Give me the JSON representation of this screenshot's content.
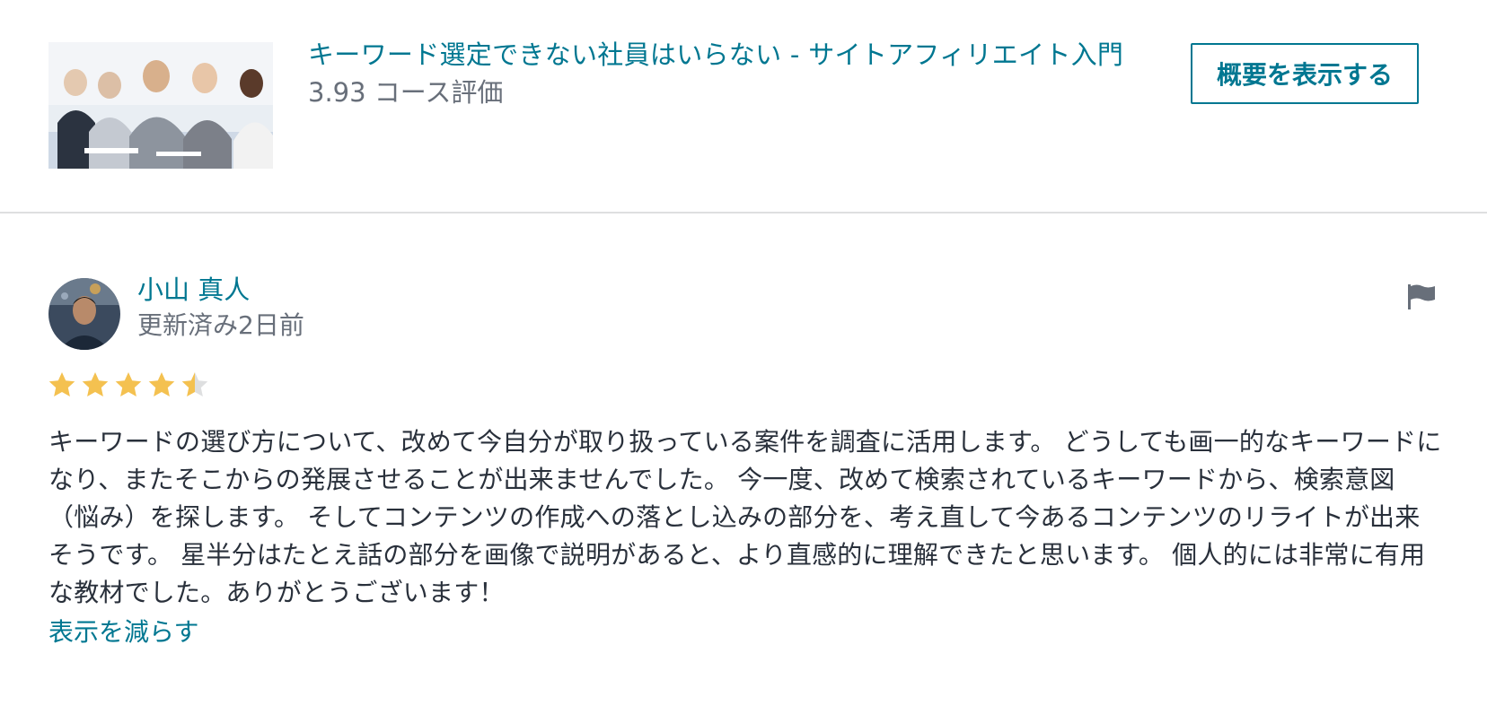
{
  "course": {
    "title": "キーワード選定できない社員はいらない - サイトアフィリエイト入門",
    "rating_text": "3.93 コース評価",
    "overview_button": "概要を表示する",
    "thumbnail_icon": "course-thumbnail-image"
  },
  "review": {
    "reviewer_name": "小山 真人",
    "updated": "更新済み2日前",
    "rating": 4.5,
    "max_rating": 5,
    "text": "キーワードの選び方について、改めて今自分が取り扱っている案件を調査に活用します。 どうしても画一的なキーワードになり、またそこからの発展させることが出来ませんでした。 今一度、改めて検索されているキーワードから、検索意図（悩み）を探します。 そしてコンテンツの作成への落とし込みの部分を、考え直して今あるコンテンツのリライトが出来そうです。 星半分はたとえ話の部分を画像で説明があると、より直感的に理解できたと思います。 個人的には非常に有用な教材でした。ありがとうございます！",
    "show_less": "表示を減らす",
    "flag_icon": "flag-icon",
    "star_icon": "star-icon"
  },
  "colors": {
    "link": "#007791",
    "text": "#29303b",
    "muted": "#686f7a",
    "star": "#f4c150",
    "star_empty": "#dedfe0",
    "divider": "#dedfe0",
    "flag": "#686f7a"
  }
}
